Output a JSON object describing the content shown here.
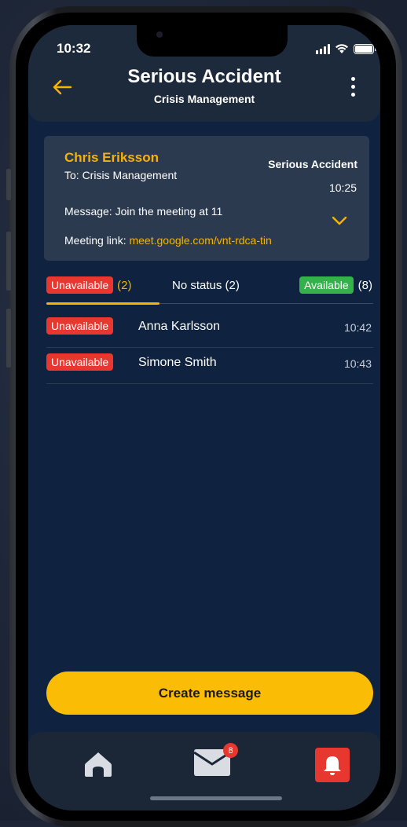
{
  "status_bar": {
    "time": "10:32"
  },
  "header": {
    "title": "Serious Accident",
    "subtitle": "Crisis Management"
  },
  "message_card": {
    "sender": "Chris Eriksson",
    "to": "To: Crisis Management",
    "title": "Serious Accident",
    "time": "10:25",
    "message": "Message: Join the meeting at 11",
    "meeting_label": "Meeting link: ",
    "meeting_link": "meet.google.com/vnt-rdca-tin"
  },
  "tabs": {
    "unavailable": {
      "label": "Unavailable",
      "count": "(2)"
    },
    "no_status": {
      "label": "No status (2)"
    },
    "available": {
      "label": "Available",
      "count": "(8)"
    },
    "active": "unavailable"
  },
  "responses": [
    {
      "status": "Unavailable",
      "name": "Anna Karlsson",
      "time": "10:42"
    },
    {
      "status": "Unavailable",
      "name": "Simone Smith",
      "time": "10:43"
    }
  ],
  "actions": {
    "create_message": "Create message"
  },
  "nav": {
    "mail_badge": "8"
  },
  "colors": {
    "accent": "#fbbc05",
    "unavailable": "#e8372e",
    "available": "#34b24a",
    "background": "#0f2340",
    "card": "#2b3a4f"
  },
  "icons": {
    "back": "arrow-left-icon",
    "menu": "more-vertical-icon",
    "expand": "chevron-down-icon",
    "home": "home-icon",
    "mail": "mail-icon",
    "alert": "bell-icon"
  }
}
